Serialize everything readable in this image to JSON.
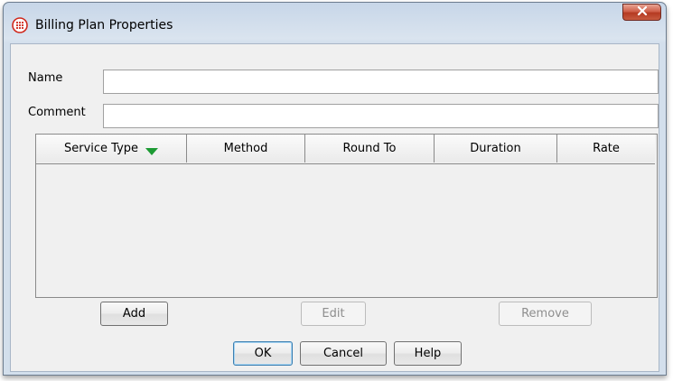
{
  "window": {
    "title": "Billing Plan Properties",
    "icon": "telephone-dial-icon",
    "close_label": "x"
  },
  "form": {
    "name_label": "Name",
    "name_value": "",
    "comment_label": "Comment",
    "comment_value": ""
  },
  "table": {
    "columns": [
      {
        "label": "Service Type",
        "sorted": "descending"
      },
      {
        "label": "Method"
      },
      {
        "label": "Round To"
      },
      {
        "label": "Duration"
      },
      {
        "label": "Rate"
      }
    ],
    "rows": []
  },
  "row_actions": {
    "add_label": "Add",
    "edit_label": "Edit",
    "remove_label": "Remove"
  },
  "footer": {
    "ok_label": "OK",
    "cancel_label": "Cancel",
    "help_label": "Help"
  },
  "colors": {
    "sort_arrow": "#1c9a33",
    "close_button": "#c75a3f",
    "icon_red": "#d0281c"
  }
}
